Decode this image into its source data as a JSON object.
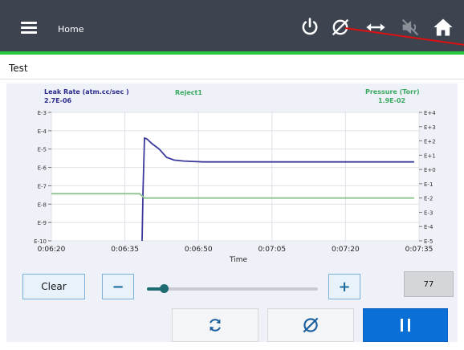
{
  "header": {
    "title": "Home",
    "icons": [
      "menu-icon",
      "power-icon",
      "reject-icon",
      "swap-horizontal-icon",
      "mute-icon",
      "home-icon"
    ]
  },
  "section": {
    "title": "Test"
  },
  "chart_data": {
    "type": "line",
    "left_axis_title": "Leak Rate (atm.cc/sec )",
    "left_axis_value": "2.7E-06",
    "right_axis_title": "Pressure (Torr)",
    "right_axis_value": "1.9E-02",
    "legend_label": "Reject1",
    "xlabel": "Time",
    "x_ticks": [
      "0:06:20",
      "0:06:35",
      "0:06:50",
      "0:07:05",
      "0:07:20",
      "0:07:35"
    ],
    "x_range_seconds": [
      380,
      455
    ],
    "left_ticks": [
      "E-3",
      "E-4",
      "E-5",
      "E-6",
      "E-7",
      "E-8",
      "E-9",
      "E-10"
    ],
    "left_log_range": [
      -10,
      -3
    ],
    "right_ticks": [
      "E+4",
      "E+3",
      "E+2",
      "E+1",
      "E+0",
      "E-1",
      "E-2",
      "E-3",
      "E-4",
      "E-5"
    ],
    "right_log_range": [
      -5,
      4
    ],
    "grid": true,
    "series": [
      {
        "name": "Leak Rate",
        "color": "#3b3a9c",
        "axis": "left",
        "points": [
          [
            398.5,
            -10
          ],
          [
            398.7,
            -7.2
          ],
          [
            399.0,
            -4.4
          ],
          [
            399.5,
            -4.45
          ],
          [
            400.5,
            -4.7
          ],
          [
            402.0,
            -5.0
          ],
          [
            403.5,
            -5.45
          ],
          [
            405.0,
            -5.6
          ],
          [
            407.0,
            -5.65
          ],
          [
            411.0,
            -5.7
          ],
          [
            454.0,
            -5.7
          ]
        ]
      },
      {
        "name": "Pressure",
        "color": "#8bc48c",
        "axis": "right",
        "points": [
          [
            380,
            -1.7
          ],
          [
            398.0,
            -1.7
          ],
          [
            399.0,
            -2.0
          ],
          [
            454.0,
            -2.0
          ]
        ]
      }
    ]
  },
  "controls": {
    "clear_label": "Clear",
    "minus_label": "−",
    "plus_label": "+",
    "slider_level": 0.1,
    "value_display": "77"
  },
  "actions": {
    "refresh": "refresh-icon",
    "reject": "reject-icon",
    "pause": "pause-icon"
  },
  "colors": {
    "accent_green": "#27c93f",
    "pause_blue": "#0a6fd6",
    "topbar": "#3d4450"
  }
}
